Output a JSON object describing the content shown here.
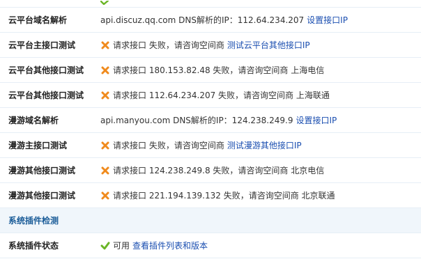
{
  "rows": [
    {
      "label": "云平台域名解析",
      "type": "plain",
      "text": "api.discuz.qq.com DNS解析的IP：112.64.234.207",
      "link": "设置接口IP"
    },
    {
      "label": "云平台主接口测试",
      "type": "fail",
      "text": "请求接口 失败，请咨询空间商",
      "link": "测试云平台其他接口IP"
    },
    {
      "label": "云平台其他接口测试",
      "type": "fail",
      "text": "请求接口 180.153.82.48 失败，请咨询空间商 上海电信",
      "link": ""
    },
    {
      "label": "云平台其他接口测试",
      "type": "fail",
      "text": "请求接口 112.64.234.207 失败，请咨询空间商 上海联通",
      "link": ""
    },
    {
      "label": "漫游域名解析",
      "type": "plain",
      "text": "api.manyou.com DNS解析的IP：124.238.249.9",
      "link": "设置接口IP"
    },
    {
      "label": "漫游主接口测试",
      "type": "fail",
      "text": "请求接口 失败，请咨询空间商",
      "link": "测试漫游其他接口IP"
    },
    {
      "label": "漫游其他接口测试",
      "type": "fail",
      "text": "请求接口 124.238.249.8 失败，请咨询空间商 北京电信",
      "link": ""
    },
    {
      "label": "漫游其他接口测试",
      "type": "fail",
      "text": "请求接口 221.194.139.132 失败，请咨询空间商 北京联通",
      "link": ""
    }
  ],
  "section": {
    "title": "系统插件检测"
  },
  "plugin_row": {
    "label": "系统插件状态",
    "status": "可用",
    "link": "查看插件列表和版本"
  },
  "colors": {
    "fail": "#f08a1c",
    "ok": "#6ab526",
    "link": "#1a4eb0",
    "section_bg": "#f0f6fb",
    "section_text": "#1a5c98"
  },
  "icons": {
    "fail": "cross-icon",
    "ok": "check-icon"
  }
}
